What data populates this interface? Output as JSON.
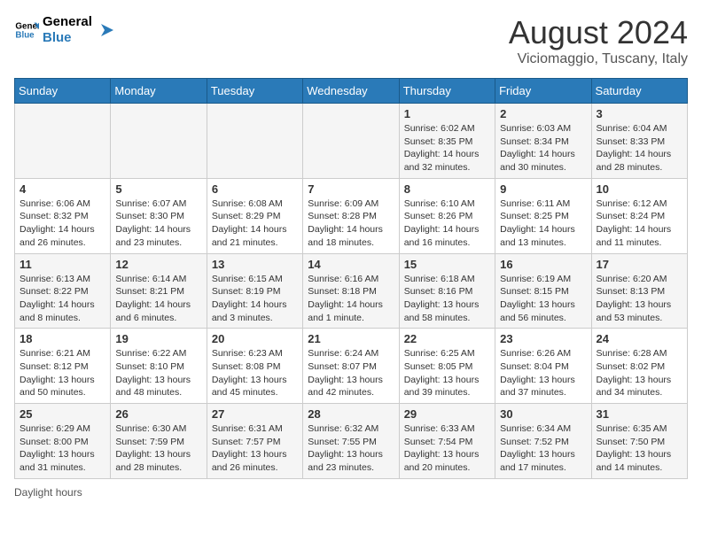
{
  "app": {
    "name": "GeneralBlue",
    "title": "August 2024",
    "subtitle": "Viciomaggio, Tuscany, Italy"
  },
  "calendar": {
    "days_of_week": [
      "Sunday",
      "Monday",
      "Tuesday",
      "Wednesday",
      "Thursday",
      "Friday",
      "Saturday"
    ],
    "weeks": [
      [
        {
          "day": "",
          "info": ""
        },
        {
          "day": "",
          "info": ""
        },
        {
          "day": "",
          "info": ""
        },
        {
          "day": "",
          "info": ""
        },
        {
          "day": "1",
          "info": "Sunrise: 6:02 AM\nSunset: 8:35 PM\nDaylight: 14 hours and 32 minutes."
        },
        {
          "day": "2",
          "info": "Sunrise: 6:03 AM\nSunset: 8:34 PM\nDaylight: 14 hours and 30 minutes."
        },
        {
          "day": "3",
          "info": "Sunrise: 6:04 AM\nSunset: 8:33 PM\nDaylight: 14 hours and 28 minutes."
        }
      ],
      [
        {
          "day": "4",
          "info": "Sunrise: 6:06 AM\nSunset: 8:32 PM\nDaylight: 14 hours and 26 minutes."
        },
        {
          "day": "5",
          "info": "Sunrise: 6:07 AM\nSunset: 8:30 PM\nDaylight: 14 hours and 23 minutes."
        },
        {
          "day": "6",
          "info": "Sunrise: 6:08 AM\nSunset: 8:29 PM\nDaylight: 14 hours and 21 minutes."
        },
        {
          "day": "7",
          "info": "Sunrise: 6:09 AM\nSunset: 8:28 PM\nDaylight: 14 hours and 18 minutes."
        },
        {
          "day": "8",
          "info": "Sunrise: 6:10 AM\nSunset: 8:26 PM\nDaylight: 14 hours and 16 minutes."
        },
        {
          "day": "9",
          "info": "Sunrise: 6:11 AM\nSunset: 8:25 PM\nDaylight: 14 hours and 13 minutes."
        },
        {
          "day": "10",
          "info": "Sunrise: 6:12 AM\nSunset: 8:24 PM\nDaylight: 14 hours and 11 minutes."
        }
      ],
      [
        {
          "day": "11",
          "info": "Sunrise: 6:13 AM\nSunset: 8:22 PM\nDaylight: 14 hours and 8 minutes."
        },
        {
          "day": "12",
          "info": "Sunrise: 6:14 AM\nSunset: 8:21 PM\nDaylight: 14 hours and 6 minutes."
        },
        {
          "day": "13",
          "info": "Sunrise: 6:15 AM\nSunset: 8:19 PM\nDaylight: 14 hours and 3 minutes."
        },
        {
          "day": "14",
          "info": "Sunrise: 6:16 AM\nSunset: 8:18 PM\nDaylight: 14 hours and 1 minute."
        },
        {
          "day": "15",
          "info": "Sunrise: 6:18 AM\nSunset: 8:16 PM\nDaylight: 13 hours and 58 minutes."
        },
        {
          "day": "16",
          "info": "Sunrise: 6:19 AM\nSunset: 8:15 PM\nDaylight: 13 hours and 56 minutes."
        },
        {
          "day": "17",
          "info": "Sunrise: 6:20 AM\nSunset: 8:13 PM\nDaylight: 13 hours and 53 minutes."
        }
      ],
      [
        {
          "day": "18",
          "info": "Sunrise: 6:21 AM\nSunset: 8:12 PM\nDaylight: 13 hours and 50 minutes."
        },
        {
          "day": "19",
          "info": "Sunrise: 6:22 AM\nSunset: 8:10 PM\nDaylight: 13 hours and 48 minutes."
        },
        {
          "day": "20",
          "info": "Sunrise: 6:23 AM\nSunset: 8:08 PM\nDaylight: 13 hours and 45 minutes."
        },
        {
          "day": "21",
          "info": "Sunrise: 6:24 AM\nSunset: 8:07 PM\nDaylight: 13 hours and 42 minutes."
        },
        {
          "day": "22",
          "info": "Sunrise: 6:25 AM\nSunset: 8:05 PM\nDaylight: 13 hours and 39 minutes."
        },
        {
          "day": "23",
          "info": "Sunrise: 6:26 AM\nSunset: 8:04 PM\nDaylight: 13 hours and 37 minutes."
        },
        {
          "day": "24",
          "info": "Sunrise: 6:28 AM\nSunset: 8:02 PM\nDaylight: 13 hours and 34 minutes."
        }
      ],
      [
        {
          "day": "25",
          "info": "Sunrise: 6:29 AM\nSunset: 8:00 PM\nDaylight: 13 hours and 31 minutes."
        },
        {
          "day": "26",
          "info": "Sunrise: 6:30 AM\nSunset: 7:59 PM\nDaylight: 13 hours and 28 minutes."
        },
        {
          "day": "27",
          "info": "Sunrise: 6:31 AM\nSunset: 7:57 PM\nDaylight: 13 hours and 26 minutes."
        },
        {
          "day": "28",
          "info": "Sunrise: 6:32 AM\nSunset: 7:55 PM\nDaylight: 13 hours and 23 minutes."
        },
        {
          "day": "29",
          "info": "Sunrise: 6:33 AM\nSunset: 7:54 PM\nDaylight: 13 hours and 20 minutes."
        },
        {
          "day": "30",
          "info": "Sunrise: 6:34 AM\nSunset: 7:52 PM\nDaylight: 13 hours and 17 minutes."
        },
        {
          "day": "31",
          "info": "Sunrise: 6:35 AM\nSunset: 7:50 PM\nDaylight: 13 hours and 14 minutes."
        }
      ]
    ]
  },
  "footer": {
    "text": "Daylight hours"
  }
}
